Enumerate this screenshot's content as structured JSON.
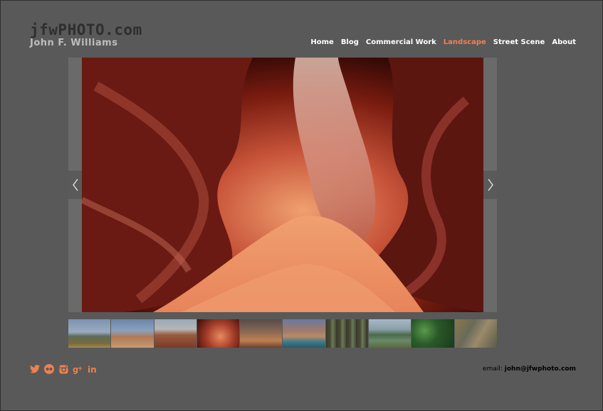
{
  "site": {
    "title": "jfwPHOTO.com",
    "subtitle": "John F. Williams"
  },
  "nav": {
    "items": [
      {
        "label": "Home"
      },
      {
        "label": "Blog"
      },
      {
        "label": "Commercial Work"
      },
      {
        "label": "Landscape",
        "active": true
      },
      {
        "label": "Street Scene"
      },
      {
        "label": "About"
      }
    ]
  },
  "gallery": {
    "prev_icon": "chevron-left-icon",
    "next_icon": "chevron-right-icon",
    "thumb_count": 10
  },
  "social": [
    "twitter-icon",
    "flickr-icon",
    "instagram-icon",
    "google-plus-icon",
    "linkedin-icon"
  ],
  "footer": {
    "email_label": "email:",
    "email": "john@jfwphoto.com"
  },
  "colors": {
    "background": "#595959",
    "accent": "#f08050",
    "title": "#2f2f2f",
    "subtitle": "#bdbdbd"
  }
}
